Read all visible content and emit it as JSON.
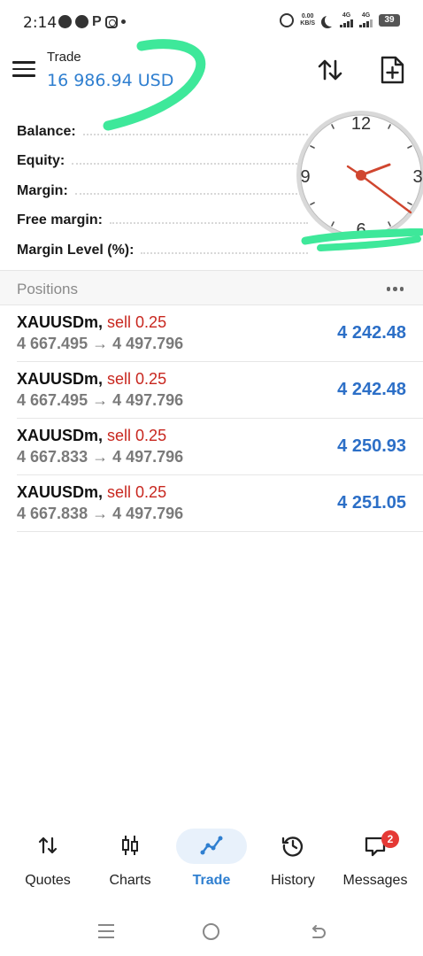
{
  "status_bar": {
    "time": "2:14",
    "speed_top": "0.00",
    "speed_bottom": "KB/S",
    "net1": "4G",
    "net2": "4G",
    "battery": "39"
  },
  "header": {
    "title": "Trade",
    "amount": "16 986.94 USD"
  },
  "summary": {
    "rows": [
      {
        "label": "Balance:"
      },
      {
        "label": "Equity:"
      },
      {
        "label": "Margin:"
      },
      {
        "label": "Free margin:"
      },
      {
        "label": "Margin Level (%):"
      }
    ]
  },
  "clock": {
    "n12": "12",
    "n3": "3",
    "n6": "6",
    "n9": "9"
  },
  "positions": {
    "title": "Positions",
    "items": [
      {
        "symbol": "XAUUSDm,",
        "side": "sell 0.25",
        "prices": "4 667.495 → 4 497.796",
        "profit": "4 242.48"
      },
      {
        "symbol": "XAUUSDm,",
        "side": "sell 0.25",
        "prices": "4 667.495 → 4 497.796",
        "profit": "4 242.48"
      },
      {
        "symbol": "XAUUSDm,",
        "side": "sell 0.25",
        "prices": "4 667.833 → 4 497.796",
        "profit": "4 250.93"
      },
      {
        "symbol": "XAUUSDm,",
        "side": "sell 0.25",
        "prices": "4 667.838 → 4 497.796",
        "profit": "4 251.05"
      }
    ]
  },
  "nav": {
    "items": [
      {
        "label": "Quotes",
        "icon": "quotes-icon"
      },
      {
        "label": "Charts",
        "icon": "charts-icon"
      },
      {
        "label": "Trade",
        "icon": "trade-icon"
      },
      {
        "label": "History",
        "icon": "history-icon"
      },
      {
        "label": "Messages",
        "icon": "messages-icon"
      }
    ],
    "active": "Trade",
    "messages_badge": "2"
  },
  "colors": {
    "accent": "#2f7fd0",
    "profit": "#2c6fc7",
    "sell": "#c8271f",
    "highlight_marker": "#3ee89a"
  }
}
